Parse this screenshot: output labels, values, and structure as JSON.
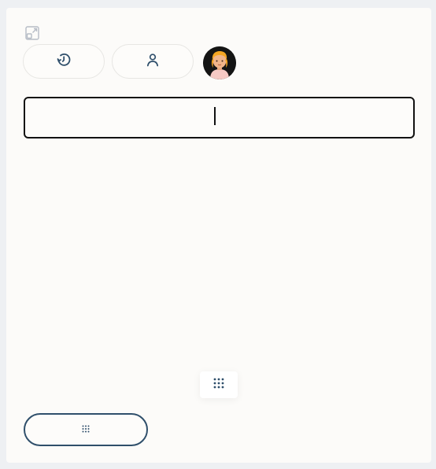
{
  "toolbar": {
    "expand_icon": "expand-window-icon",
    "history_icon": "history-icon",
    "profile_icon": "user-icon",
    "avatar_alt": "user-avatar"
  },
  "input": {
    "value": "",
    "placeholder": ""
  },
  "drag_handle": {
    "icon": "grid-dots-icon"
  },
  "bottom_button": {
    "icon": "grid-dots-icon",
    "label": ""
  },
  "colors": {
    "accent": "#2f4f6b",
    "border_light": "#e7e6e3",
    "panel_bg": "#fcfbf9",
    "page_bg": "#eef0f3"
  }
}
